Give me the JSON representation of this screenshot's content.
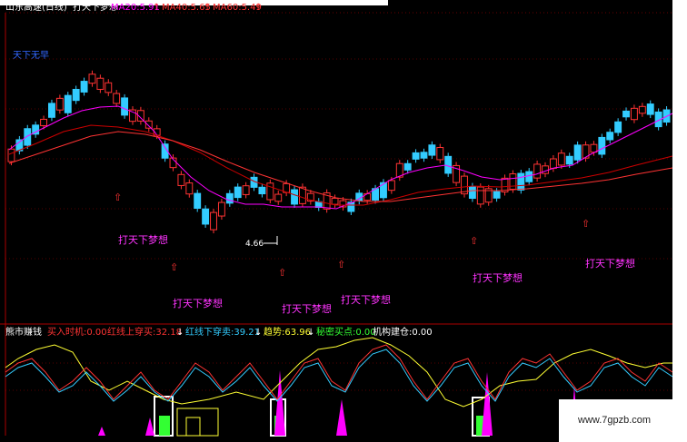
{
  "header": {
    "stock_label": "山东高速(日线)",
    "indicator_name": "打天下梦想",
    "ma": [
      {
        "label": "MA20:5.91",
        "color": "#ff00ff"
      },
      {
        "label": "MA40:5.65",
        "color": "#ff3333"
      },
      {
        "label": "MA60:5.49",
        "color": "#ff3333"
      }
    ]
  },
  "chart_note": "天下无早",
  "price_marker": "4.66",
  "signal_label": "打天下梦想",
  "indicator_panel": {
    "name": "熊市赚钱",
    "items": [
      {
        "label": "买入时机:0.00",
        "color": "#ff3333"
      },
      {
        "label": "红线上穿买:32.18",
        "color": "#ff3333"
      },
      {
        "label": "红线下穿卖:39.21",
        "color": "#33ccff"
      },
      {
        "label": "趋势:63.96",
        "color": "#ffff33"
      },
      {
        "label": "秘密买点:0.00",
        "color": "#33ff33"
      },
      {
        "label": "机构建仓:0.00",
        "color": "#ffffff"
      }
    ]
  },
  "watermark": "www.7gpzb.com",
  "colors": {
    "up": "#ff3333",
    "down": "#33ccff",
    "ma20": "#ff00ff",
    "ma40": "#cc0000",
    "ma60": "#ff3333"
  }
}
